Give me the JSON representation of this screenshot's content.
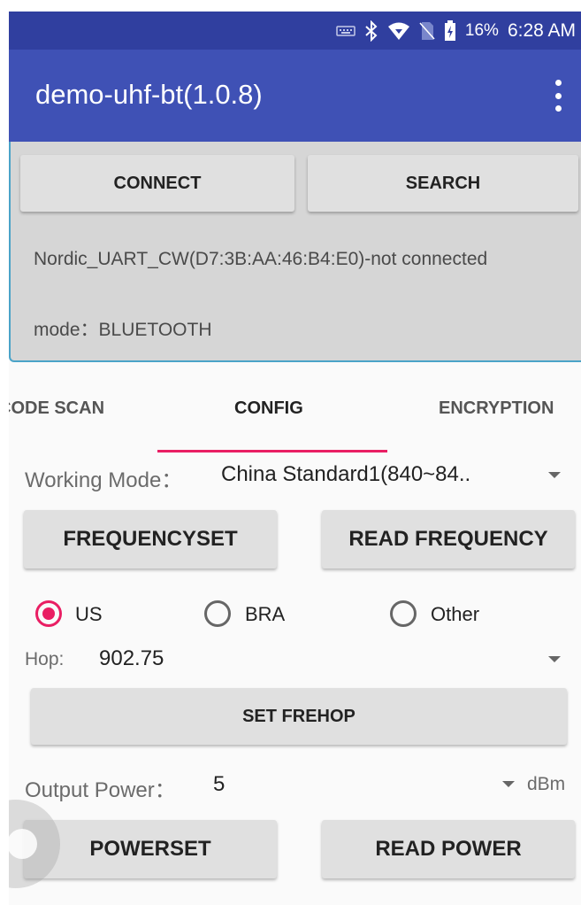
{
  "status_bar": {
    "battery": "16%",
    "time": "6:28 AM",
    "icons": [
      "keyboard-icon",
      "bluetooth-icon",
      "wifi-icon",
      "no-sim-icon",
      "battery-charging-icon"
    ]
  },
  "app_bar": {
    "title": "demo-uhf-bt(1.0.8)",
    "menu_icon": "more-vert-icon"
  },
  "connection": {
    "connect_label": "CONNECT",
    "search_label": "SEARCH",
    "device_status": "Nordic_UART_CW(D7:3B:AA:46:B4:E0)-not connected",
    "mode": "mode：BLUETOOTH"
  },
  "tabs": [
    {
      "label": "CODE SCAN",
      "active": false
    },
    {
      "label": "CONFIG",
      "active": true
    },
    {
      "label": "ENCRYPTION",
      "active": false
    }
  ],
  "config": {
    "working_mode_label": "Working Mode：",
    "working_mode_value": "China Standard1(840~84..",
    "frequencyset_label": "FREQUENCYSET",
    "read_frequency_label": "READ FREQUENCY",
    "regions": [
      {
        "label": "US",
        "checked": true
      },
      {
        "label": "BRA",
        "checked": false
      },
      {
        "label": "Other",
        "checked": false
      }
    ],
    "hop_label": "Hop:",
    "hop_value": "902.75",
    "set_frehop_label": "SET FREHOP",
    "output_power_label": "Output Power：",
    "output_power_value": "5",
    "output_power_unit": "dBm",
    "powerset_label": "POWERSET",
    "read_power_label": "READ POWER"
  },
  "colors": {
    "status_bar": "#303f9f",
    "app_bar": "#3f51b5",
    "accent": "#e91e63",
    "panel": "#d6d6d6"
  }
}
